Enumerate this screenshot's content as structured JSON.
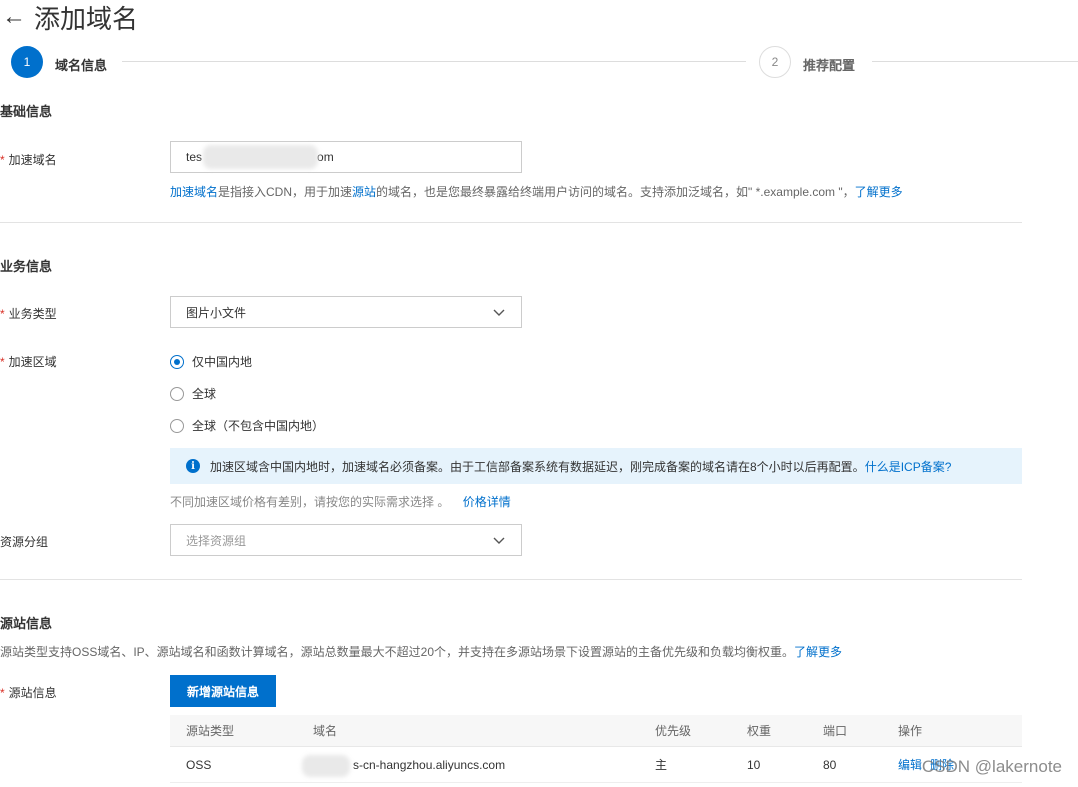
{
  "header": {
    "title": "添加域名"
  },
  "steps": [
    {
      "number": "1",
      "label": "域名信息",
      "active": true
    },
    {
      "number": "2",
      "label": "推荐配置",
      "active": false
    }
  ],
  "basic": {
    "section_title": "基础信息",
    "domain_label": "加速域名",
    "domain_value_prefix": "tes",
    "domain_value_suffix": "om",
    "help_link": "加速域名",
    "help_mid1": "是指接入CDN，用于加速",
    "help_link2": "源站",
    "help_mid2": "的域名，也是您最终暴露给终端用户访问的域名。支持添加泛域名，如\" *.example.com \"，",
    "help_more": "了解更多"
  },
  "business": {
    "section_title": "业务信息",
    "type_label": "业务类型",
    "type_value": "图片小文件",
    "region_label": "加速区域",
    "region_options": [
      "仅中国内地",
      "全球",
      "全球（不包含中国内地）"
    ],
    "region_selected": 0,
    "notice_text": "加速区域含中国内地时，加速域名必须备案。由于工信部备案系统有数据延迟，刚完成备案的域名请在8个小时以后再配置。",
    "notice_link": "什么是ICP备案?",
    "price_note": "不同加速区域价格有差别，请按您的实际需求选择 。",
    "price_link": "价格详情",
    "group_label": "资源分组",
    "group_placeholder": "选择资源组"
  },
  "origin": {
    "section_title": "源站信息",
    "desc": "源站类型支持OSS域名、IP、源站域名和函数计算域名，源站总数量最大不超过20个，并支持在多源站场景下设置源站的主备优先级和负载均衡权重。",
    "desc_link": "了解更多",
    "label": "源站信息",
    "add_button": "新增源站信息",
    "table": {
      "headers": [
        "源站类型",
        "域名",
        "优先级",
        "权重",
        "端口",
        "操作"
      ],
      "rows": [
        {
          "type": "OSS",
          "domain": "s-cn-hangzhou.aliyuncs.com",
          "priority": "主",
          "weight": "10",
          "port": "80",
          "edit": "编辑",
          "delete": "删除"
        }
      ]
    }
  },
  "watermark": "CSDN @lakernote",
  "colors": {
    "primary": "#0070cc",
    "required": "#d93026",
    "notice_bg": "#e6f3fc"
  }
}
